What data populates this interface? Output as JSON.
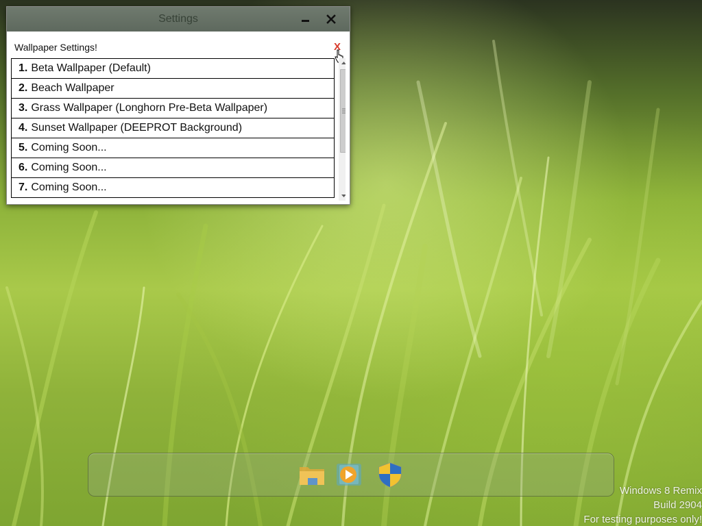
{
  "window": {
    "title": "Settings",
    "minimize_icon": "minimize-icon",
    "close_icon": "close-icon"
  },
  "panel": {
    "heading": "Wallpaper Settings!",
    "close_label": "X"
  },
  "wallpapers": [
    {
      "num": "1.",
      "label": "Beta Wallpaper (Default)"
    },
    {
      "num": "2.",
      "label": "Beach Wallpaper"
    },
    {
      "num": "3.",
      "label": "Grass Wallpaper (Longhorn Pre-Beta Wallpaper)"
    },
    {
      "num": "4.",
      "label": "Sunset Wallpaper (DEEPROT Background)"
    },
    {
      "num": "5.",
      "label": "Coming Soon..."
    },
    {
      "num": "6.",
      "label": "Coming Soon..."
    },
    {
      "num": "7.",
      "label": "Coming Soon..."
    }
  ],
  "dock": {
    "items": [
      {
        "icon": "folder-icon"
      },
      {
        "icon": "media-player-icon"
      },
      {
        "icon": "security-shield-icon"
      }
    ]
  },
  "watermark": {
    "line1": "Windows 8 Remix",
    "line2": "Build 2904",
    "line3": "For testing purposes only!"
  },
  "colors": {
    "close_red": "#d83a2b",
    "titlebar": "#6f7a6e"
  }
}
